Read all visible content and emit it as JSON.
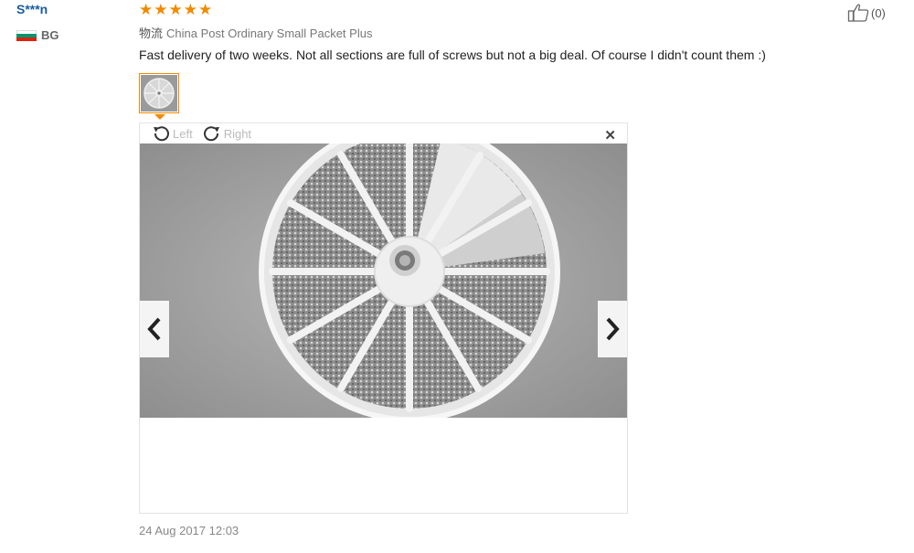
{
  "reviewer": {
    "name": "S***n",
    "country": "BG",
    "flag_colors": [
      "#ffffff",
      "#00966e",
      "#d62612"
    ]
  },
  "review": {
    "rating": 5,
    "max_rating": 5,
    "star_color": "#f08a00",
    "logistics_label": "物流",
    "logistics_value": "China Post Ordinary Small Packet Plus",
    "text": "Fast delivery of two weeks. Not all sections are full of screws but not a big deal. Of course I didn't count them :)",
    "date": "24 Aug 2017 12:03"
  },
  "viewer": {
    "rotate_left_label": "Left",
    "rotate_right_label": "Right",
    "close_icon": "close-icon",
    "prev_icon": "chevron-left-icon",
    "next_icon": "chevron-right-icon"
  },
  "helpful": {
    "count_text": "(0)",
    "icon": "thumbs-up-icon"
  }
}
